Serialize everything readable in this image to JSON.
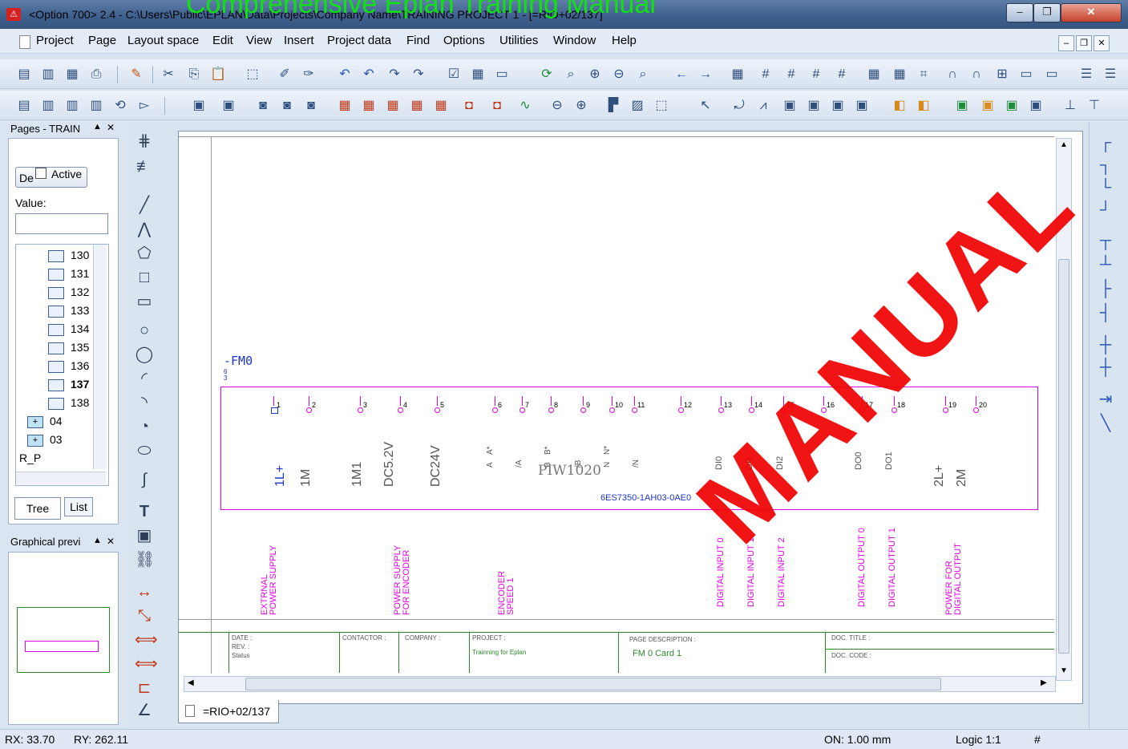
{
  "window": {
    "title": "<Option 700> 2.4 - C:\\Users\\Public\\EPLAN\\Data\\Projects\\Company Name\\TRAINING PROJECT 1 - [=RIO+02/137]",
    "min": "–",
    "max": "❐",
    "close": "✕"
  },
  "overlay_text": "Comprehensive Eplan Training Manual",
  "menu": [
    "Project",
    "Page",
    "Layout space",
    "Edit",
    "View",
    "Insert",
    "Project data",
    "Find",
    "Options",
    "Utilities",
    "Window",
    "Help"
  ],
  "pages_panel": {
    "title": "Pages - TRAIN",
    "filter_btn": "De",
    "active_label": "Active",
    "value_label": "Value:",
    "tree": [
      "130",
      "131",
      "132",
      "133",
      "134",
      "135",
      "136",
      "137",
      "138"
    ],
    "groups": [
      "04",
      "03"
    ],
    "rp": "R_P",
    "tabs": [
      "Tree",
      "List"
    ]
  },
  "preview_panel": {
    "title": "Graphical previ"
  },
  "document_tab": "=RIO+02/137",
  "drawing": {
    "device_tag": "-FM0",
    "device_ref": "6\n3",
    "module_name": "PIW1020",
    "order_no": "6ES7350-1AH03-0AE0",
    "terminals": [
      "1",
      "2",
      "3",
      "4",
      "5",
      "6",
      "7",
      "8",
      "9",
      "10",
      "11",
      "12",
      "13",
      "14",
      "15",
      "16",
      "17",
      "18",
      "19",
      "20"
    ],
    "signals": [
      "1L+",
      "1M",
      "1M1",
      "DC5.2V",
      "DC24V",
      "A",
      "/A",
      "B",
      "/B",
      "N",
      "/N",
      "DI0",
      "DI1",
      "DI2",
      "DO0",
      "DO1",
      "2L+",
      "2M"
    ],
    "signal_extra": [
      "A*",
      "B*",
      "N*"
    ],
    "functions": [
      "EXTRNAL POWER SUPPLY",
      "POWER SUPPLY FOR ENCODER",
      "ENCODER SPEED 1",
      "DIGITAL INPUT 0",
      "DIGITAL INPUT 1",
      "DIGITAL INPUT 2",
      "DIGITAL OUTPUT 0",
      "DIGITAL OUTPUT 1",
      "POWER FOR DIGITAL OUTPUT"
    ],
    "title_block": {
      "date": "DATE :",
      "rev": "REV. :",
      "status": "Status",
      "contractor": "CONTACTOR :",
      "company": "COMPANY :",
      "project": "PROJECT :",
      "project_val": "Trainning for Eplan",
      "page_desc": "PAGE DESCRIPTION :",
      "page_desc_val": "FM 0 Card 1",
      "doc_title": "DOC. TITLE :",
      "doc_code": "DOC. CODE :"
    }
  },
  "watermark": "MANUAL",
  "status": {
    "rx": "RX: 33.70",
    "ry": "RY: 262.11",
    "on": "ON: 1.00 mm",
    "logic": "Logic 1:1",
    "hash": "#"
  }
}
